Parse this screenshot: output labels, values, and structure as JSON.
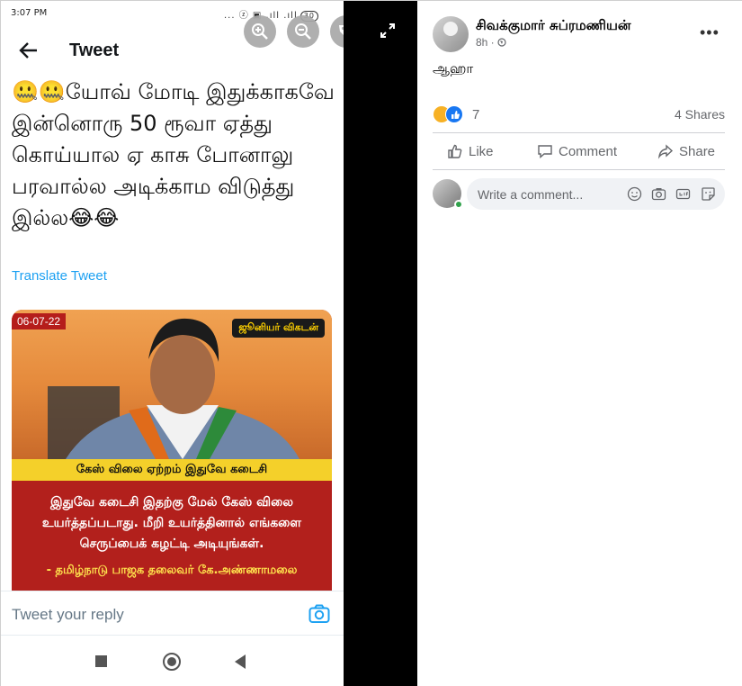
{
  "phone": {
    "status_time": "3:07 PM",
    "status_icons": "... ⓩ ▣ .ıll .ıll",
    "battery": "30"
  },
  "tweet": {
    "header_title": "Tweet",
    "text": "🤐🤐யோவ் மோடி இதுக்காகவே இன்னொரு 50 ரூவா ஏத்து கொய்யால ஏ காசு போனாலு பரவால்ல அடிக்காம விடுத்து இல்ல😂😂",
    "translate_label": "Translate Tweet",
    "reply_placeholder": "Tweet your reply"
  },
  "news_card": {
    "date": "06-07-22",
    "logo": "ஜூனியர் விகடன்",
    "headline": "கேஸ் விலை ஏற்றம் இதுவே கடைசி",
    "quote": "இதுவே கடைசி இதற்கு மேல் கேஸ் விலை உயர்த்தப்படாது. மீறி உயர்த்தினால் எங்களை செருப்பைக் கழட்டி அடியுங்கள்.",
    "author": "- தமிழ்நாடு பாஜக தலைவர் கே.அண்ணாமலை"
  },
  "facebook": {
    "author_name": "சிவக்குமார் சுப்ரமணியன்",
    "time": "8h · ",
    "post_text": "ஆஹா",
    "reaction_count": "7",
    "shares": "4 Shares",
    "actions": {
      "like": "Like",
      "comment": "Comment",
      "share": "Share"
    },
    "comment_placeholder": "Write a comment..."
  },
  "colors": {
    "twitter_blue": "#1da1f2",
    "facebook_blue": "#1877f2",
    "card_red": "#b2201c",
    "card_yellow": "#f4d02a"
  }
}
